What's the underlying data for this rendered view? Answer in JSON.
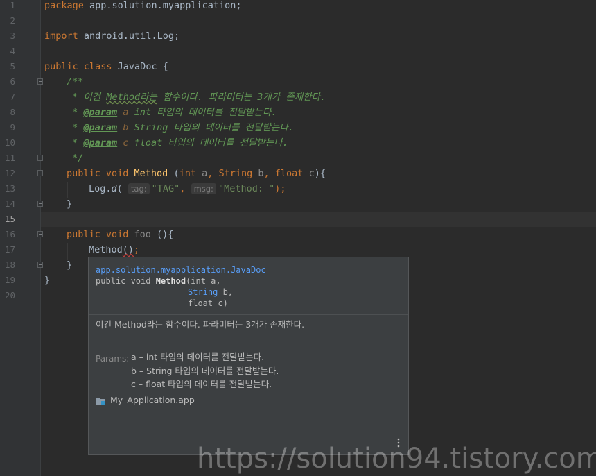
{
  "line_numbers": [
    "1",
    "2",
    "3",
    "4",
    "5",
    "6",
    "7",
    "8",
    "9",
    "10",
    "11",
    "12",
    "13",
    "14",
    "15",
    "16",
    "17",
    "18",
    "19",
    "20"
  ],
  "code": {
    "l1_kw": "package",
    "l1_rest": " app.solution.myapplication;",
    "l3_kw": "import",
    "l3_rest": " android.util.Log;",
    "l5_kw": "public class",
    "l5_name": " JavaDoc",
    "l5_brace": " {",
    "l6": "/**",
    "l7_a": " * 이건 ",
    "l7_b": "Method라는",
    "l7_c": " 함수이다. 파라미터는 3개가 존재한다.",
    "l8_pre": " * ",
    "l8_tag": "@param",
    "l8_val": " a",
    "l8_rest": " int 타입의 데이터를 전달받는다.",
    "l9_pre": " * ",
    "l9_tag": "@param",
    "l9_val": " b",
    "l9_rest": " String 타입의 데이터를 전달받는다.",
    "l10_pre": " * ",
    "l10_tag": "@param",
    "l10_val": " c",
    "l10_rest": " float 타입의 데이터를 전달받는다.",
    "l11": " */",
    "l12_kw1": "public void",
    "l12_method": " Method",
    "l12_p1": " (",
    "l12_int": "int",
    "l12_a": " a",
    "l12_comma1": ", String",
    "l12_b": " b",
    "l12_comma2": ", ",
    "l12_float": "float",
    "l12_c": " c",
    "l12_end": "){",
    "l13_a": "Log.",
    "l13_d": "d",
    "l13_p": "( ",
    "l13_hint1": "tag:",
    "l13_s1": "\"TAG\"",
    "l13_comma": ", ",
    "l13_hint2": "msg:",
    "l13_s2": "\"Method: \"",
    "l13_end": ");",
    "l14": "}",
    "l16_kw": "public void",
    "l16_name": " foo",
    "l16_end": " (){",
    "l17_a": "Method",
    "l17_b": "()",
    "l17_c": ";",
    "l18": "}",
    "l19": "}"
  },
  "popup": {
    "package": "app.solution.myapplication.JavaDoc",
    "sig1_a": "public void ",
    "sig1_name": "Method",
    "sig1_b": "(int a,",
    "sig2": "String",
    "sig2_rest": " b,",
    "sig3": "float c)",
    "description": "이건 Method라는 함수이다. 파라미터는 3개가 존재한다.",
    "params_label": "Params:",
    "param1": "a – int 타입의 데이터를 전달받는다.",
    "param2": "b – String 타입의 데이터를 전달받는다.",
    "param3": "c – float 타입의 데이터를 전달받는다.",
    "module": "My_Application.app"
  },
  "watermark": "https://solution94.tistory.com/",
  "colors": {
    "editor_bg": "#2b2b2b",
    "keyword": "#cc7832",
    "doc_comment": "#629755",
    "string": "#6a8759",
    "popup_bg": "#3c3f41",
    "link": "#589df6"
  },
  "icons": [
    "fold-icon",
    "folder-module-icon",
    "more-vertical-icon"
  ]
}
